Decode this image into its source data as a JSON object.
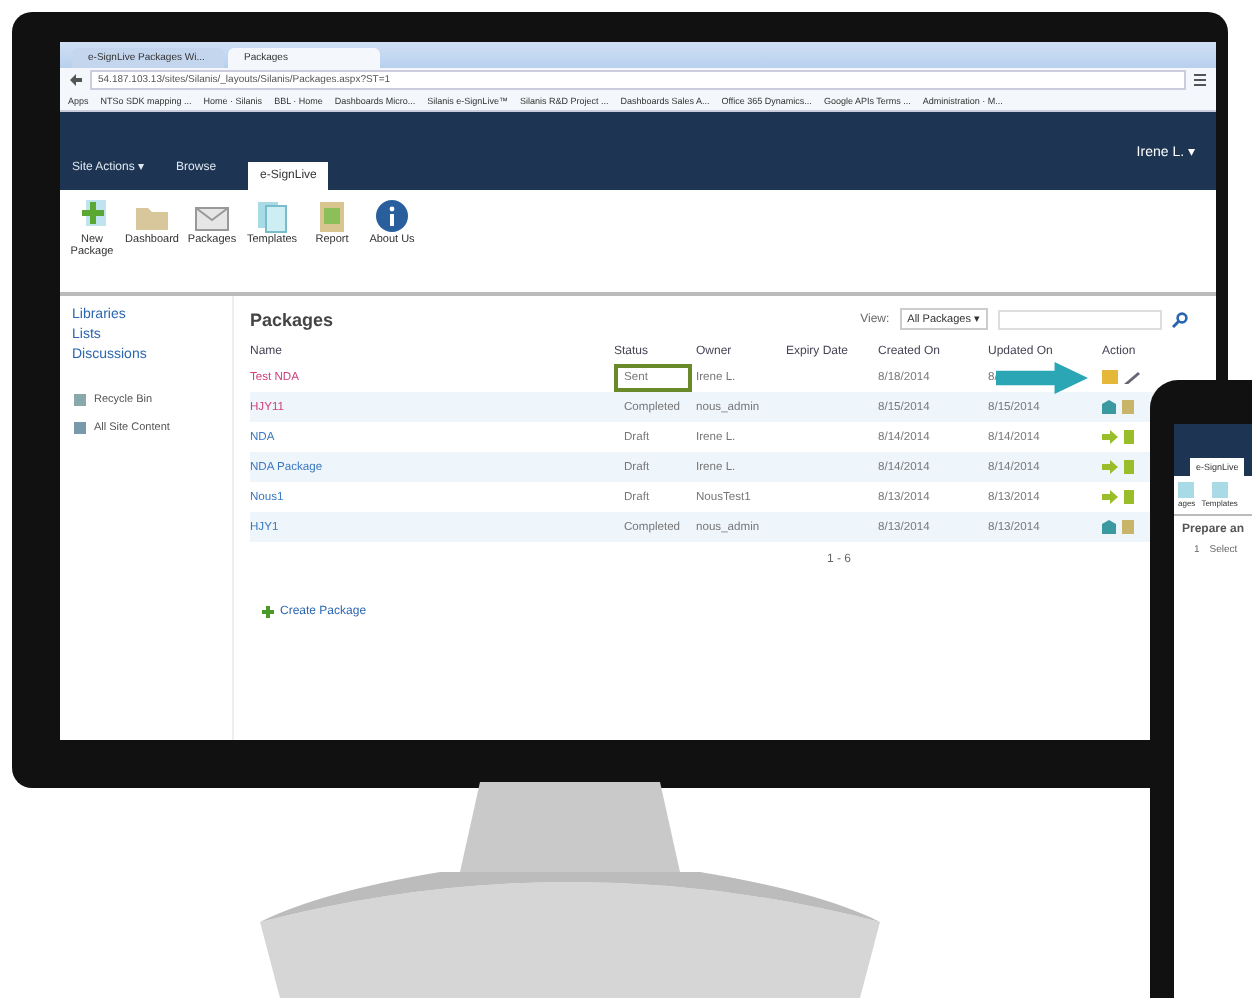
{
  "browser": {
    "tabs": [
      {
        "label": "e-SignLive Packages Wi...",
        "selected": false
      },
      {
        "label": "Packages",
        "selected": true
      }
    ],
    "url": "54.187.103.13/sites/Silanis/_layouts/Silanis/Packages.aspx?ST=1",
    "bookmarks": [
      "Apps",
      "NTSo SDK mapping ...",
      "Home · Silanis",
      "BBL · Home",
      "Dashboards Micro...",
      "Silanis e-SignLive™",
      "Silanis R&D Project ...",
      "Dashboards Sales A...",
      "Office 365 Dynamics...",
      "Google APIs Terms ...",
      "Administration · M..."
    ]
  },
  "carets": {
    "site_actions": "▾",
    "user": "▾",
    "view": "▾"
  },
  "topbar": {
    "site_actions": "Site Actions",
    "tabs": [
      {
        "label": "Browse",
        "selected": false
      },
      {
        "label": "e-SignLive",
        "selected": true
      }
    ],
    "user": "Irene L."
  },
  "ribbon": [
    {
      "kind": "new",
      "label": "New Package"
    },
    {
      "kind": "dashboard",
      "label": "Dashboard"
    },
    {
      "kind": "packages",
      "label": "Packages"
    },
    {
      "kind": "templates",
      "label": "Templates"
    },
    {
      "kind": "report",
      "label": "Report"
    },
    {
      "kind": "about",
      "label": "About Us"
    }
  ],
  "sidebar": {
    "links": [
      "Libraries",
      "Lists",
      "Discussions"
    ],
    "items": [
      {
        "kind": "recycle",
        "label": "Recycle Bin"
      },
      {
        "kind": "content",
        "label": "All Site Content"
      }
    ]
  },
  "main": {
    "title": "Packages",
    "view_label": "View:",
    "view_value": "All Packages",
    "columns": [
      "Name",
      "Status",
      "Owner",
      "Expiry Date",
      "Created On",
      "Updated On",
      "Action"
    ],
    "rows": [
      {
        "name": "Test NDA",
        "color": "#d0407a",
        "status": "Sent",
        "owner": "Irene L.",
        "created": "8/18/2014",
        "updated": "8/",
        "kind": "sent",
        "highlighted": true
      },
      {
        "name": "HJY11",
        "color": "#d0407a",
        "status": "Completed",
        "owner": "nous_admin",
        "created": "8/15/2014",
        "updated": "8/15/2014",
        "kind": "completed",
        "highlighted": false
      },
      {
        "name": "NDA",
        "color": "#3a78c0",
        "status": "Draft",
        "owner": "Irene L.",
        "created": "8/14/2014",
        "updated": "8/14/2014",
        "kind": "draft",
        "highlighted": false
      },
      {
        "name": "NDA Package",
        "color": "#3a78c0",
        "status": "Draft",
        "owner": "Irene L.",
        "created": "8/14/2014",
        "updated": "8/14/2014",
        "kind": "draft",
        "highlighted": false
      },
      {
        "name": "Nous1",
        "color": "#3a78c0",
        "status": "Draft",
        "owner": "NousTest1",
        "created": "8/13/2014",
        "updated": "8/13/2014",
        "kind": "draft",
        "highlighted": false
      },
      {
        "name": "HJY1",
        "color": "#3a78c0",
        "status": "Completed",
        "owner": "nous_admin",
        "created": "8/13/2014",
        "updated": "8/13/2014",
        "kind": "completed",
        "highlighted": false
      }
    ],
    "pager": "1 - 6",
    "create": "Create Package"
  },
  "tablet": {
    "tab": "e-SignLive",
    "icons": [
      "ages",
      "Templates"
    ],
    "heading": "Prepare an",
    "step": "1",
    "step_label": "Select"
  }
}
